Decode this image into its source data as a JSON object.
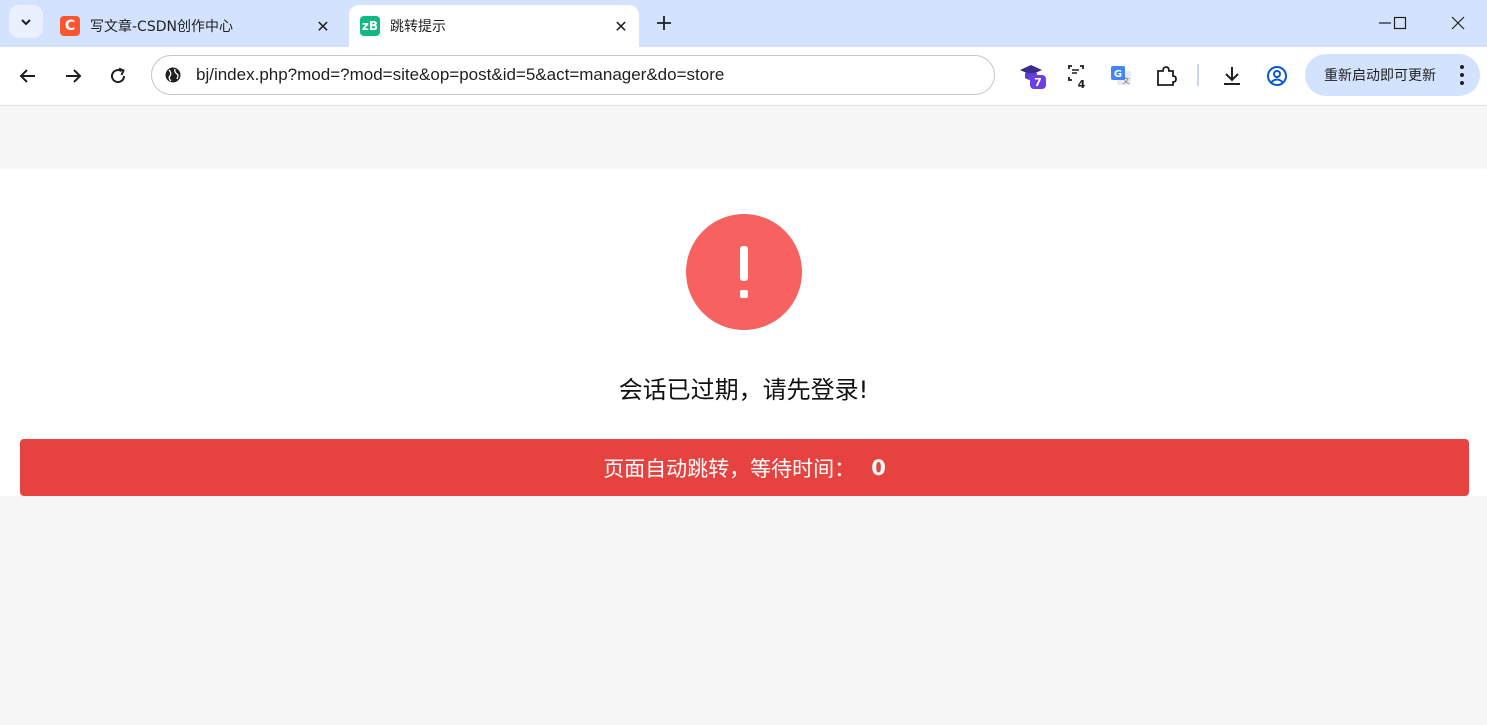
{
  "browser": {
    "tabs": [
      {
        "title": "写文章-CSDN创作中心",
        "favicon": "C",
        "active": false
      },
      {
        "title": "跳转提示",
        "favicon": "zB",
        "active": true
      }
    ],
    "url": "bj/index.php?mod=?mod=site&op=post&id=5&act=manager&do=store",
    "extensions": [
      {
        "icon": "graduation-cap-extension-icon",
        "badge": "7"
      },
      {
        "icon": "screenshot-extension-icon",
        "badge": "4"
      },
      {
        "icon": "google-translate-icon"
      },
      {
        "icon": "puzzle-extensions-icon"
      }
    ],
    "restart_label": "重新启动即可更新"
  },
  "page": {
    "message": "会话已过期，请先登录!",
    "redirect_text": "页面自动跳转，等待时间：",
    "countdown": "0"
  },
  "colors": {
    "alert": "#f76260",
    "redirect_bar": "#e64340",
    "tabstrip": "#d3e3fd"
  }
}
